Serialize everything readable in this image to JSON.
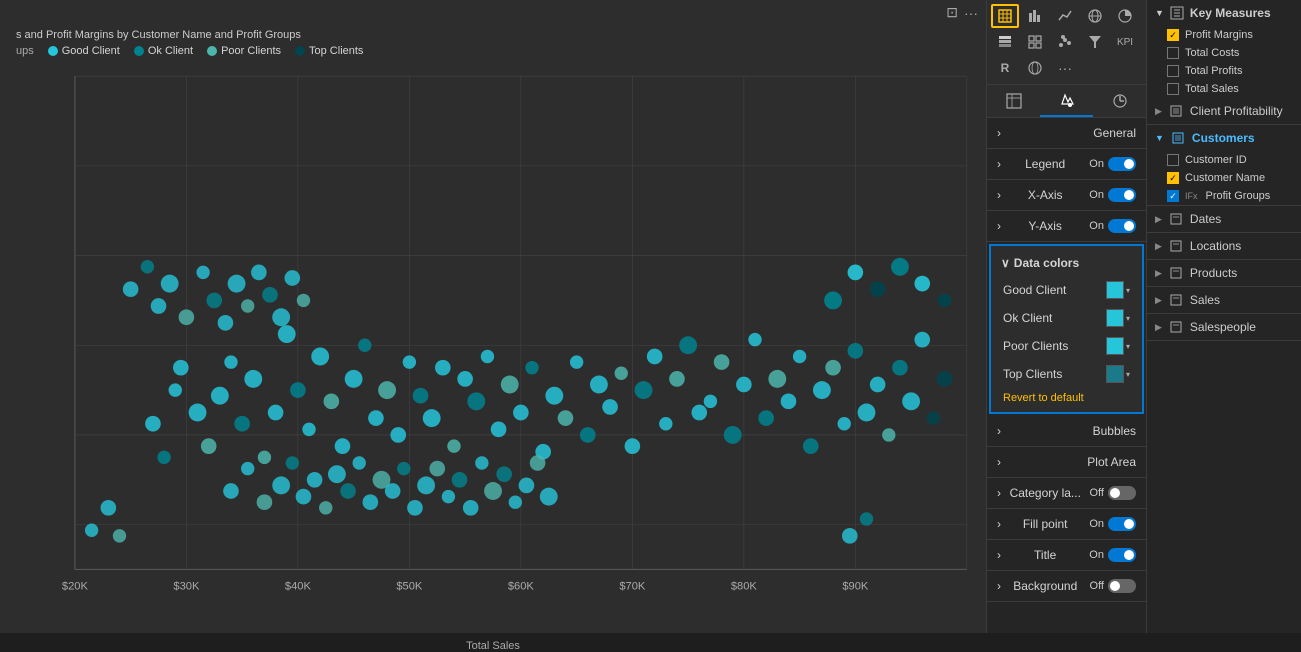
{
  "chart": {
    "title": "s and Profit Margins by Customer Name and Profit Groups",
    "x_axis_label": "Total Sales",
    "legend": {
      "prefix": "ups",
      "items": [
        {
          "label": "Good Client",
          "color": "#26c6da"
        },
        {
          "label": "Ok Client",
          "color": "#00838f"
        },
        {
          "label": "Poor Clients",
          "color": "#4db6ac"
        },
        {
          "label": "Top Clients",
          "color": "#00454f"
        }
      ]
    },
    "x_ticks": [
      "$20K",
      "$30K",
      "$40K",
      "$50K",
      "$60K",
      "$70K",
      "$80K",
      "$90K"
    ],
    "toolbar": {
      "icon1": "≡",
      "icon2": "⊡",
      "icon3": "···"
    }
  },
  "format_panel": {
    "tabs": [
      {
        "label": "⊞",
        "name": "fields"
      },
      {
        "label": "🖌",
        "name": "format",
        "active": true
      },
      {
        "label": "⚡",
        "name": "analytics"
      }
    ],
    "sections": [
      {
        "label": "General",
        "expanded": false
      },
      {
        "label": "Legend",
        "toggle": "On",
        "toggle_state": "on"
      },
      {
        "label": "X-Axis",
        "toggle": "On",
        "toggle_state": "on"
      },
      {
        "label": "Y-Axis",
        "toggle": "On",
        "toggle_state": "on"
      },
      {
        "label": "Data colors",
        "expanded": true
      },
      {
        "label": "Bubbles",
        "expanded": false
      },
      {
        "label": "Plot Area",
        "expanded": false
      },
      {
        "label": "Category la...",
        "toggle": "Off",
        "toggle_state": "off"
      },
      {
        "label": "Fill point",
        "toggle": "On",
        "toggle_state": "on"
      },
      {
        "label": "Title",
        "toggle": "On",
        "toggle_state": "on"
      },
      {
        "label": "Background",
        "toggle": "Off",
        "toggle_state": "off"
      }
    ],
    "data_colors": {
      "header": "Data colors",
      "items": [
        {
          "label": "Good Client",
          "color": "#26c6da"
        },
        {
          "label": "Ok Client",
          "color": "#26c6da"
        },
        {
          "label": "Poor Clients",
          "color": "#26c6da"
        },
        {
          "label": "Top Clients",
          "color": "#1a7a8a"
        }
      ],
      "revert_label": "Revert to default"
    }
  },
  "fields_panel": {
    "key_measures_label": "Key Measures",
    "sections": [
      {
        "label": "Key Measures",
        "items": [
          {
            "label": "Profit Margins",
            "checked": true,
            "checkbox_type": "yellow"
          },
          {
            "label": "Total Costs",
            "checked": false
          },
          {
            "label": "Total Profits",
            "checked": false
          },
          {
            "label": "Total Sales",
            "checked": false
          }
        ]
      },
      {
        "label": "Client Profitability",
        "expanded": false,
        "items": []
      },
      {
        "label": "Customers",
        "expanded": true,
        "highlighted": true,
        "items": [
          {
            "label": "Customer ID",
            "checked": false
          },
          {
            "label": "Customer Name",
            "checked": true,
            "checkbox_type": "yellow"
          },
          {
            "label": "Profit Groups",
            "checked": true,
            "checkbox_type": "blue",
            "icon": "IFx"
          }
        ]
      },
      {
        "label": "Dates",
        "expanded": false,
        "items": []
      },
      {
        "label": "Locations",
        "expanded": false,
        "items": []
      },
      {
        "label": "Products",
        "expanded": false,
        "items": []
      },
      {
        "label": "Sales",
        "expanded": false,
        "items": []
      },
      {
        "label": "Salespeople",
        "expanded": false,
        "items": []
      }
    ]
  },
  "vis_icons": {
    "row1": [
      "⊞",
      "📊",
      "📈",
      "🗺",
      "🥧",
      "≡",
      "⊡"
    ],
    "row2": [
      "⊟",
      "Ⅱ",
      "🎯",
      "🔢",
      "R",
      "🌐",
      "···"
    ]
  },
  "colors": {
    "accent_blue": "#0078d4",
    "accent_yellow": "#ffc000",
    "good_client": "#26c6da",
    "ok_client": "#00838f",
    "poor_clients": "#4db6ac",
    "top_clients": "#00454f",
    "bg_panel": "#252526",
    "bg_chart": "#2d2d2d"
  }
}
